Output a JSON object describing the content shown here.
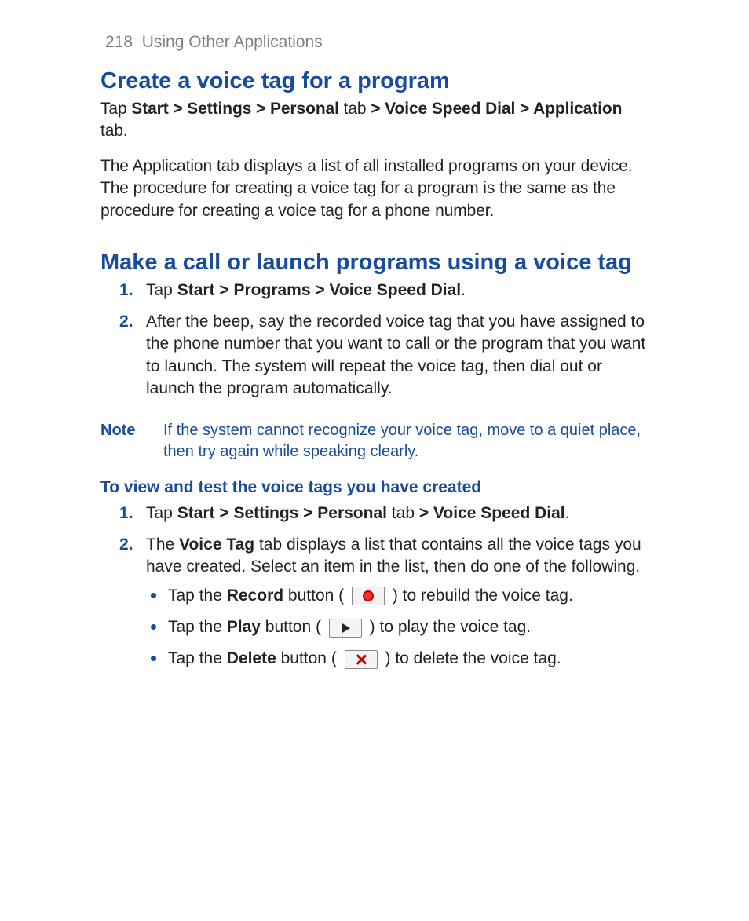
{
  "header": {
    "page_number": "218",
    "chapter": "Using Other Applications"
  },
  "section1": {
    "title": "Create a voice tag for a program",
    "lead": {
      "pre": "Tap ",
      "b1": "Start > Settings > Personal",
      "mid1": " tab ",
      "gt1": "> ",
      "b2": "Voice Speed Dial",
      "mid2": " ",
      "gt2": "> ",
      "b3": "Application",
      "post": " tab."
    },
    "body": "The Application tab displays a list of all installed programs on your device. The procedure for creating a voice tag for a program is the same as the procedure for creating a voice tag for a phone number."
  },
  "section2": {
    "title": "Make a call or launch programs using a voice tag",
    "steps": [
      {
        "pre": "Tap ",
        "b1": "Start > Programs > Voice Speed Dial",
        "post": "."
      },
      {
        "text": "After the beep, say the recorded voice tag that you have assigned to the phone number that you want to call or the program that you want to launch. The system will repeat the voice tag, then dial out or launch the program automatically."
      }
    ],
    "note_label": "Note",
    "note_text": "If the system cannot recognize your voice tag, move to a quiet place, then try again while speaking clearly."
  },
  "section3": {
    "subheading": "To view and test the voice tags you have created",
    "steps": [
      {
        "pre": "Tap ",
        "b1": "Start > Settings > Personal",
        "mid": " tab ",
        "gt": "> ",
        "b2": "Voice Speed Dial",
        "post": "."
      },
      {
        "pre": "The ",
        "b1": "Voice Tag",
        "post": " tab displays a list that contains all the voice tags you have created. Select an item in the list, then do one of the following."
      }
    ],
    "bullets": {
      "record": {
        "pre": "Tap the ",
        "b": "Record",
        "mid": " button ( ",
        "post": " ) to rebuild the voice tag."
      },
      "play": {
        "pre": "Tap the ",
        "b": "Play",
        "mid": " button ( ",
        "post": " ) to play the voice tag."
      },
      "delete": {
        "pre": "Tap the ",
        "b": "Delete",
        "mid": " button ( ",
        "post": " ) to delete the voice tag."
      }
    }
  }
}
